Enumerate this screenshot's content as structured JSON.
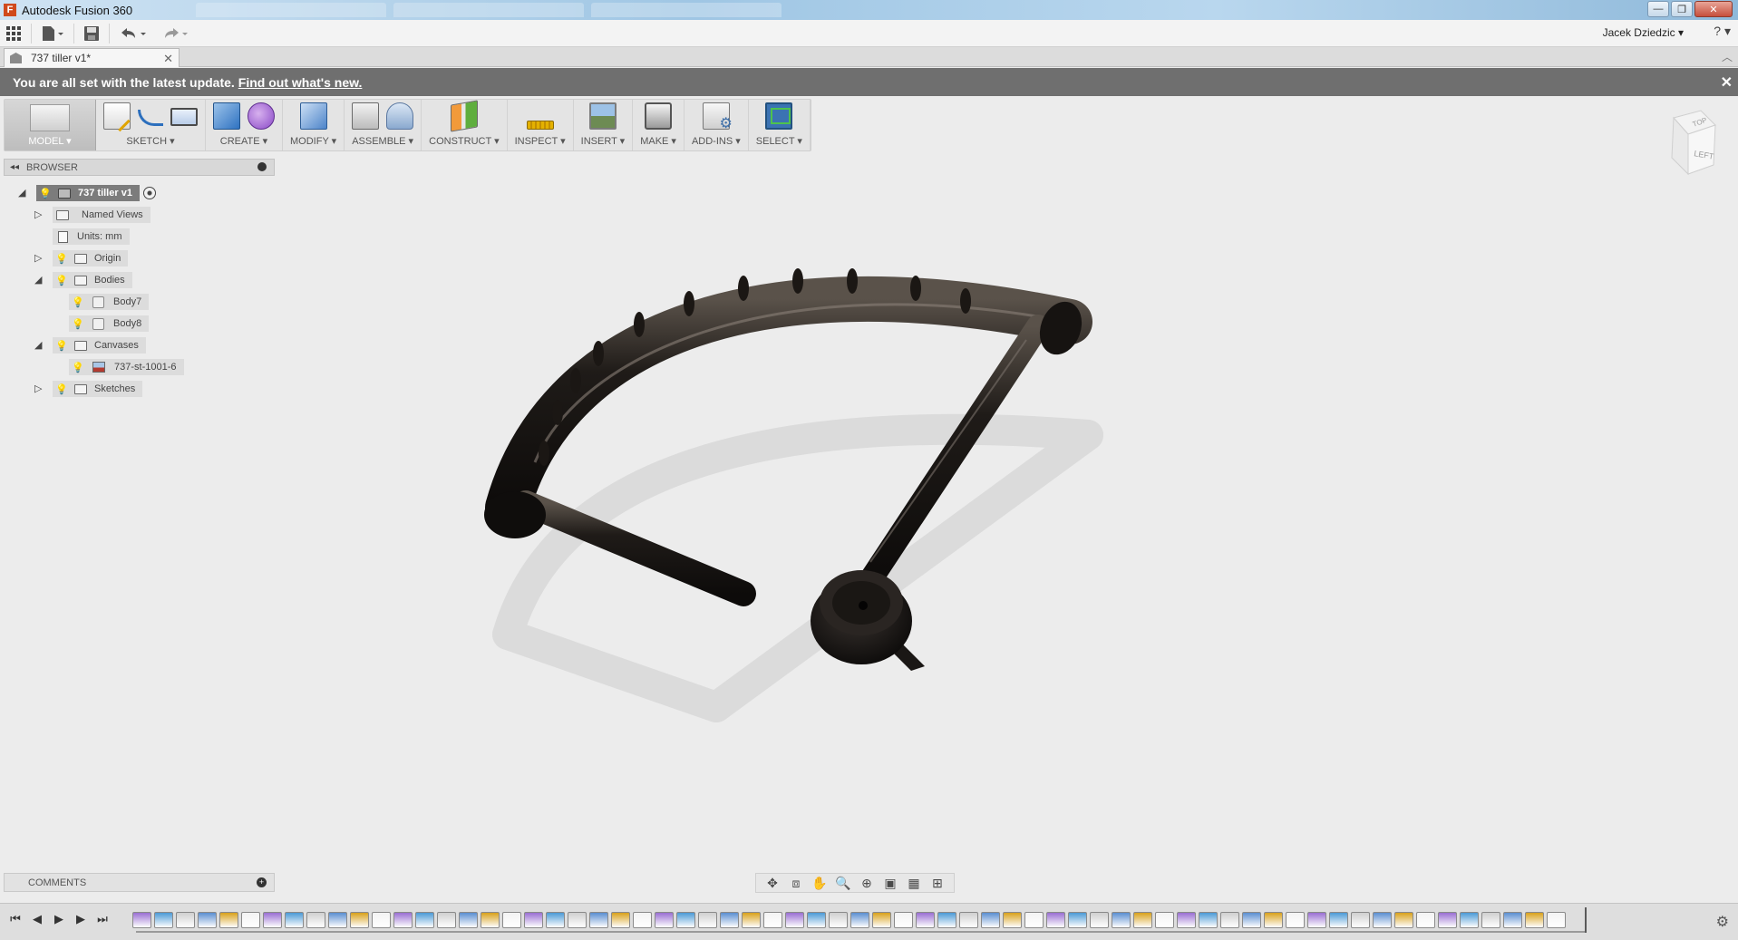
{
  "window": {
    "title": "Autodesk Fusion 360",
    "logo_letter": "F",
    "controls": {
      "minimize": "—",
      "restore": "❐",
      "close": "✕"
    }
  },
  "qat": {
    "apps_icon": "apps-grid-icon",
    "file_icon": "file-icon",
    "save_icon": "save-icon",
    "undo_icon": "undo-icon",
    "redo_icon": "redo-icon",
    "user_name": "Jacek Dziedzic ▾",
    "help_label": "? ▾"
  },
  "document_tab": {
    "name": "737 tiller v1*",
    "close": "✕",
    "collapse": "︿"
  },
  "notification": {
    "message": "You are all set with the latest update.",
    "link": "Find out what's new.",
    "close": "✕"
  },
  "ribbon": {
    "workspace": "MODEL ▾",
    "groups": [
      {
        "label": "SKETCH ▾"
      },
      {
        "label": "CREATE ▾"
      },
      {
        "label": "MODIFY ▾"
      },
      {
        "label": "ASSEMBLE ▾"
      },
      {
        "label": "CONSTRUCT ▾"
      },
      {
        "label": "INSPECT ▾"
      },
      {
        "label": "INSERT ▾"
      },
      {
        "label": "MAKE ▾"
      },
      {
        "label": "ADD-INS ▾"
      },
      {
        "label": "SELECT ▾"
      }
    ]
  },
  "browser": {
    "title": "BROWSER",
    "collapse": "◂◂",
    "root": "737 tiller v1",
    "items": [
      {
        "label": "Named Views"
      },
      {
        "label": "Units: mm"
      },
      {
        "label": "Origin"
      },
      {
        "label": "Bodies"
      },
      {
        "label": "Body7"
      },
      {
        "label": "Body8"
      },
      {
        "label": "Canvases"
      },
      {
        "label": "737-st-1001-6"
      },
      {
        "label": "Sketches"
      }
    ]
  },
  "viewcube": {
    "top": "TOP",
    "left": "LEFT"
  },
  "comments": {
    "title": "COMMENTS",
    "add": "+"
  },
  "navbar": {
    "icons": [
      "orbit-icon",
      "look-at-icon",
      "pan-icon",
      "zoom-icon",
      "fit-icon",
      "display-settings-icon",
      "grid-icon",
      "viewports-icon"
    ]
  },
  "timeline": {
    "controls": [
      "⏮",
      "◀",
      "▶",
      "▶",
      "⏭"
    ],
    "settings": "⚙",
    "feature_colors": [
      "#5b8fd1",
      "#d9a11c",
      "#f3f3f3",
      "#9a6fd3",
      "#4c9ad6",
      "#d0d0d0"
    ]
  },
  "model": {
    "body_color": "#1a1714",
    "shadow_color": "#c9c9c9"
  }
}
